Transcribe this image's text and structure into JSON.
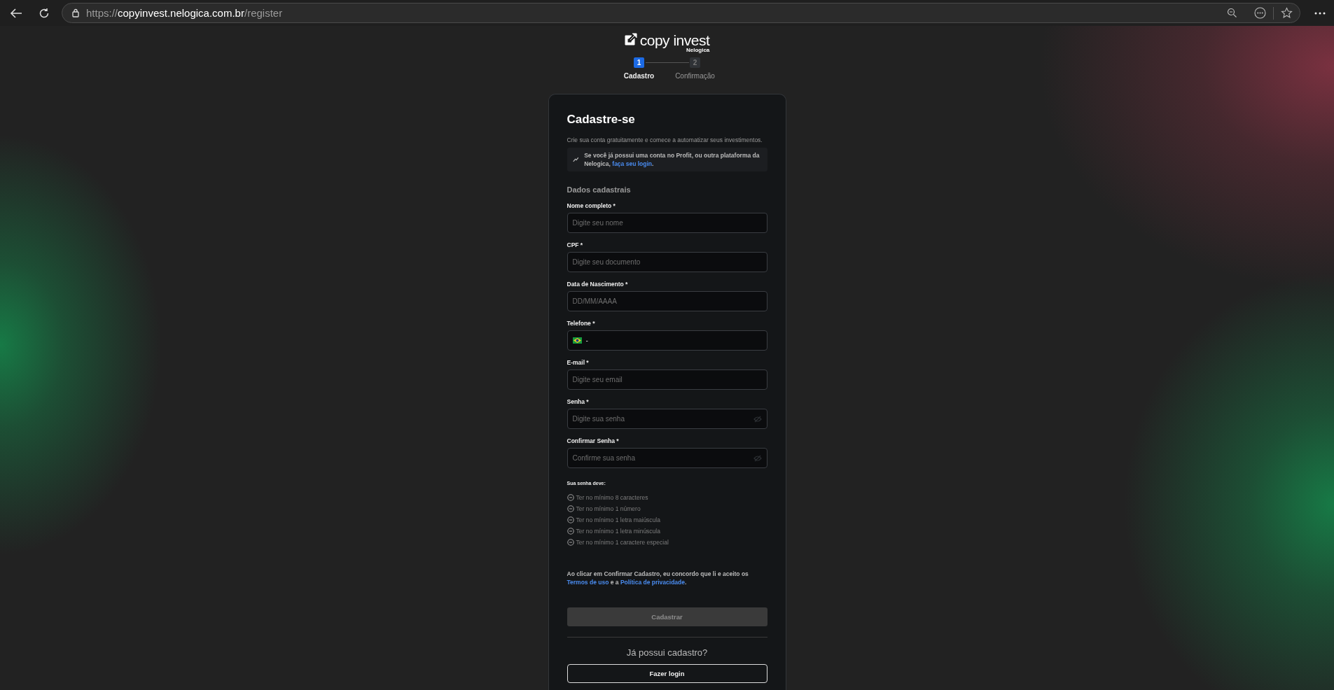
{
  "browser": {
    "url_scheme": "https://",
    "url_host": "copyinvest.nelogica.com.br",
    "url_path": "/register"
  },
  "logo": {
    "name": "copy invest",
    "company": "Nelogica"
  },
  "steps": [
    {
      "number": "1",
      "label": "Cadastro",
      "selected": true
    },
    {
      "number": "2",
      "label": "Confirmação",
      "selected": false
    }
  ],
  "card": {
    "title": "Cadastre-se",
    "subtitle": "Crie sua conta gratuitamente e comece a automatizar seus investimentos.",
    "notice": {
      "text": "Se você já possui uma conta no Profit, ou outra plataforma da Nelogica, ",
      "link": "faça seu login",
      "tail": "."
    },
    "section": "Dados cadastrais",
    "fields": [
      {
        "kind": "text",
        "label": "Nome completo *",
        "placeholder": "Digite seu nome"
      },
      {
        "kind": "text",
        "label": "CPF *",
        "placeholder": "Digite seu documento"
      },
      {
        "kind": "text",
        "label": "Data de Nascimento *",
        "placeholder": "DD/MM/AAAA"
      },
      {
        "kind": "phone",
        "label": "Telefone *",
        "value": "-"
      },
      {
        "kind": "text",
        "label": "E-mail *",
        "placeholder": "Digite seu email"
      },
      {
        "kind": "password",
        "label": "Senha *",
        "placeholder": "Digite sua senha"
      },
      {
        "kind": "password",
        "label": "Confirmar Senha *",
        "placeholder": "Confirme sua senha"
      }
    ],
    "password_rules": {
      "title": "Sua senha deve:",
      "items": [
        {
          "text": "Ter no mínimo 8 caracteres",
          "met": false
        },
        {
          "text": "Ter no mínimo 1 número",
          "met": false
        },
        {
          "text": "Ter no mínimo 1 letra maiúscula",
          "met": false
        },
        {
          "text": "Ter no mínimo 1 letra minúscula",
          "met": false
        },
        {
          "text": "Ter no mínimo 1 caractere especial",
          "met": false
        }
      ]
    },
    "terms": {
      "before": "Ao clicar em Confirmar Cadastro, eu concordo que li e aceito os ",
      "link1": "Termos de uso",
      "middle": " e a ",
      "link2": "Política de privacidade",
      "after": "."
    },
    "submit": {
      "label": "Cadastrar",
      "disabled": true
    },
    "login_prompt": "Já possui cadastro?",
    "login_button": "Fazer login"
  }
}
